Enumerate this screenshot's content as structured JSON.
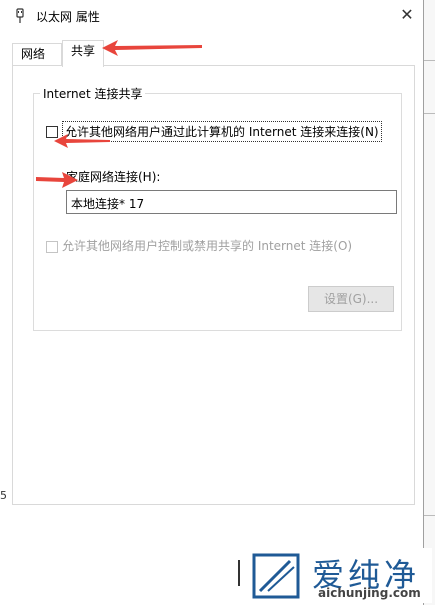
{
  "window": {
    "title": "以太网 属性",
    "close_glyph": "✕"
  },
  "tabs": [
    {
      "label": "网络",
      "active": false
    },
    {
      "label": "共享",
      "active": true
    }
  ],
  "group": {
    "title": "Internet 连接共享",
    "allow_share_label": "允许其他网络用户通过此计算机的 Internet 连接来连接(N)",
    "allow_share_checked": false,
    "home_network_label": "家庭网络连接(H):",
    "home_network_value": "本地连接* 17",
    "allow_control_label": "允许其他网络用户控制或禁用共享的 Internet 连接(O)",
    "allow_control_checked": false,
    "allow_control_enabled": false,
    "settings_button": "设置(G)..."
  },
  "background": {
    "stray_text": "5"
  },
  "watermark": {
    "title": "爱纯净",
    "url": "aichunjing.com"
  },
  "colors": {
    "arrow": "#e8453c",
    "watermark_blue": "#1f5a96",
    "disabled_text": "#a0a0a0"
  }
}
